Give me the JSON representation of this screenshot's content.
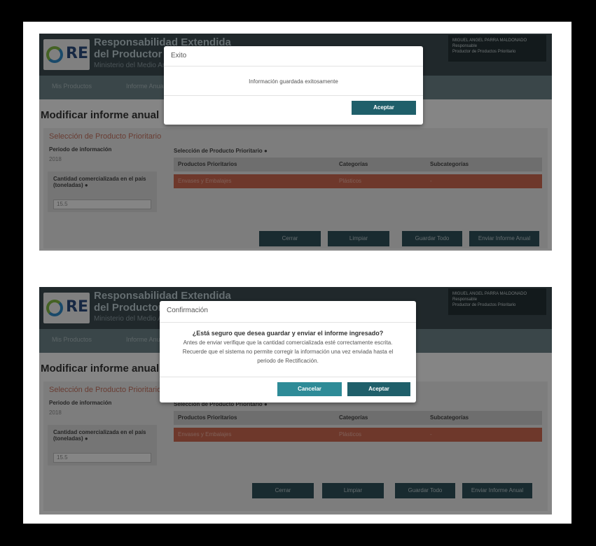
{
  "colors": {
    "header": "#3b4a4f",
    "nav": "#6b8086",
    "accent_row": "#c8664f",
    "primary_button": "#1f5f6a",
    "cancel_button": "#2e8b97"
  },
  "header": {
    "logo_text": "RE",
    "title_line1": "Responsabilidad Extendida",
    "title_line2": "del Productor",
    "ministry": "Ministerio del Medio Ambiente",
    "user_name": "MIGUEL ANGEL PARRA MALDONADO",
    "user_role": "Responsable",
    "user_type": "Productor de Productos Prioritario"
  },
  "nav": {
    "item1": "Mis Productos",
    "item2": "Informe Anual"
  },
  "page": {
    "title": "Modificar informe anual",
    "section_title": "Selección de Producto Prioritario",
    "period_label": "Periodo de información",
    "period_value": "2018",
    "qty_label_line1": "Cantidad comercializada en el país",
    "qty_label_line2": "(toneladas)",
    "qty_value": "15.5",
    "table_label": "Selección de Producto Prioritario",
    "columns": [
      "Productos Prioritarios",
      "Categorías",
      "Subcategorías"
    ],
    "row": [
      "Envases y Embalajes",
      "Plásticos",
      "-"
    ],
    "buttons": {
      "close": "Cerrar",
      "clear": "Limpiar",
      "save": "Guardar Todo",
      "send": "Enviar Informe Anual"
    }
  },
  "modal1": {
    "title": "Exito",
    "message": "Información guardada exitosamente",
    "accept": "Aceptar"
  },
  "modal2": {
    "title": "Confirmación",
    "question": "¿Está seguro que desea guardar y enviar el informe ingresado?",
    "line1": "Antes de enviar verifique que la cantidad comercializada esté correctamente escrita.",
    "line2": "Recuerde que el sistema no permite corregir la información una vez enviada hasta el",
    "line3": "periodo de Rectificación.",
    "cancel": "Cancelar",
    "accept": "Aceptar"
  }
}
